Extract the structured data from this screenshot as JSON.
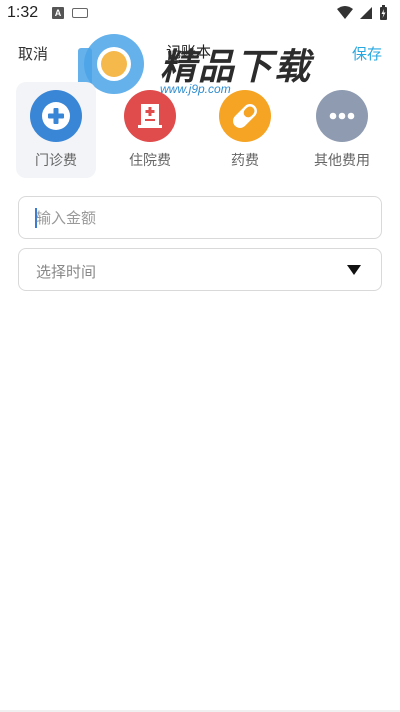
{
  "status_bar": {
    "time": "1:32",
    "notification_icon": "A",
    "icons": [
      "wifi-icon",
      "signal-icon",
      "battery-icon"
    ]
  },
  "header": {
    "cancel_label": "取消",
    "title": "记账本",
    "save_label": "保存",
    "save_color": "#29a8e0"
  },
  "watermark": {
    "text": "精品下载",
    "url": "www.j9p.com"
  },
  "categories": [
    {
      "label": "门诊费",
      "icon": "plus-cross-icon",
      "color": "#3a86d6",
      "selected": true
    },
    {
      "label": "住院费",
      "icon": "hospital-building-icon",
      "color": "#e04b4b",
      "selected": false
    },
    {
      "label": "药费",
      "icon": "pill-icon",
      "color": "#f5a423",
      "selected": false
    },
    {
      "label": "其他费用",
      "icon": "more-dots-icon",
      "color": "#8e9bb0",
      "selected": false
    }
  ],
  "form": {
    "amount_placeholder": "输入金额",
    "amount_value": "",
    "time_placeholder": "选择时间"
  }
}
